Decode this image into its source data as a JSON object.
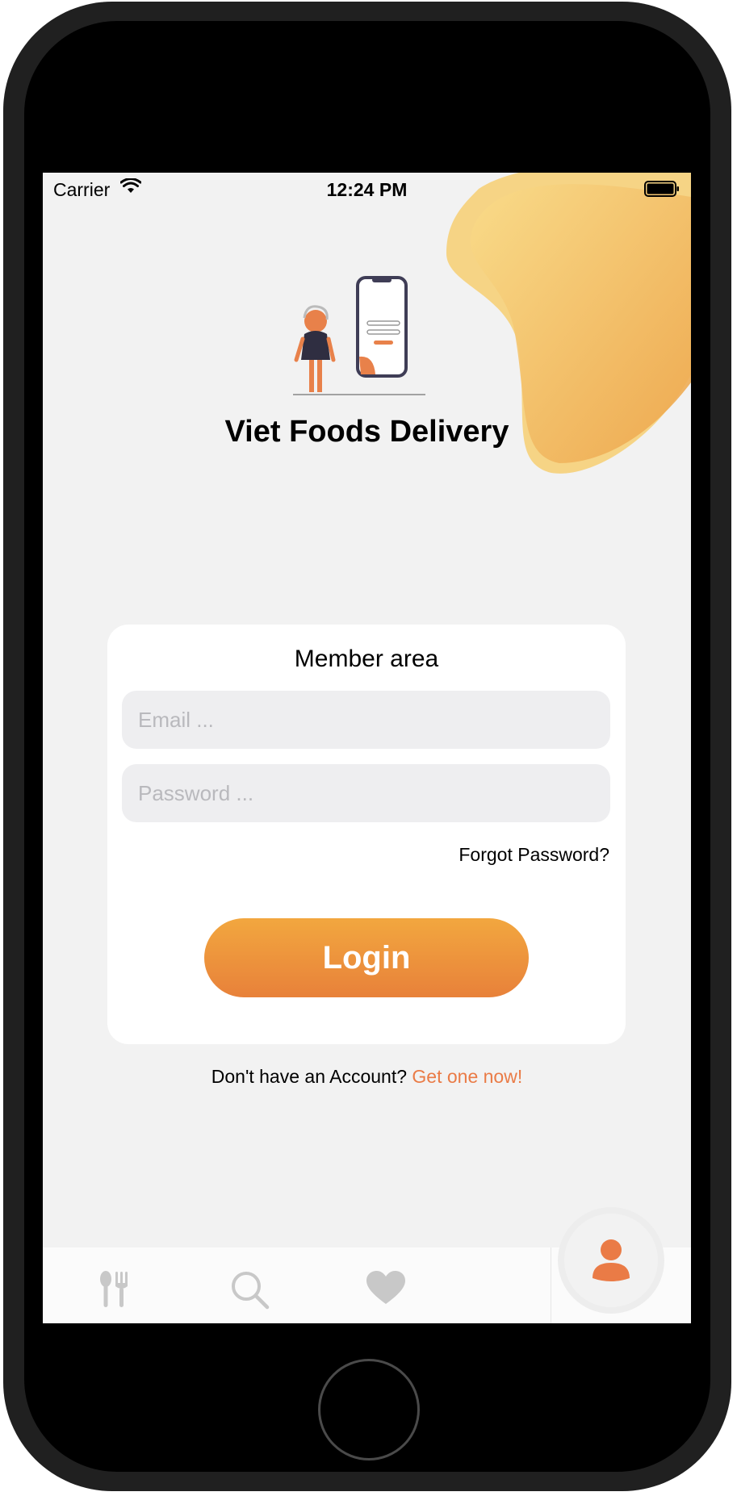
{
  "status_bar": {
    "carrier": "Carrier",
    "time": "12:24 PM"
  },
  "app": {
    "title": "Viet Foods Delivery"
  },
  "login_card": {
    "title": "Member area",
    "email_placeholder": "Email ...",
    "password_placeholder": "Password ...",
    "forgot_label": "Forgot Password?",
    "login_label": "Login"
  },
  "signup": {
    "prompt": "Don't have an Account?",
    "link": "Get one now!"
  },
  "tabs": [
    {
      "icon": "cutlery-icon"
    },
    {
      "icon": "search-icon"
    },
    {
      "icon": "heart-icon"
    },
    {
      "icon": "user-icon",
      "selected": true
    }
  ],
  "colors": {
    "accent": "#EA7B46",
    "button_gradient_top": "#F2A73F",
    "button_gradient_bottom": "#E8813A",
    "blob_yellow": "#F7CE6A",
    "screen_bg": "#F2F2F2",
    "tab_icon_inactive": "#C8C8C8"
  }
}
